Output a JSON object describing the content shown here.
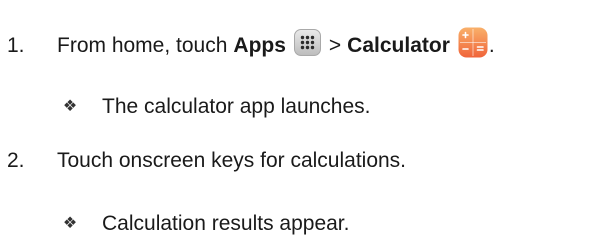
{
  "steps": [
    {
      "number": "1.",
      "text_before": "From home, touch",
      "bold_1": "Apps",
      "separator": ">",
      "bold_2": "Calculator",
      "text_after": ".",
      "result": "The calculator app launches."
    },
    {
      "number": "2.",
      "text": "Touch onscreen keys for calculations.",
      "result": "Calculation results appear."
    }
  ],
  "icons": {
    "apps": "apps-grid-icon",
    "calculator": "calculator-app-icon",
    "bullet": "diamond-bullet-icon"
  },
  "colors": {
    "calculator_top": "#f7a55a",
    "calculator_bottom": "#f26a3a"
  }
}
